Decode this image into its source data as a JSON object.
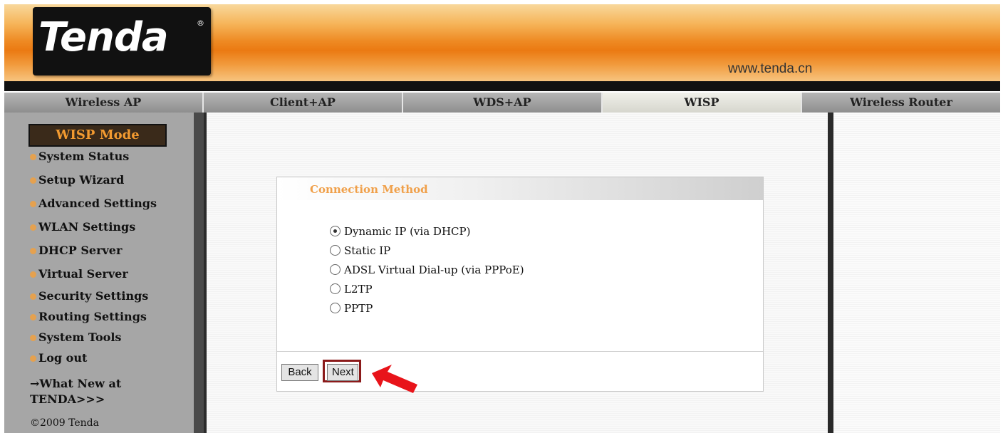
{
  "header": {
    "logo_text": "Tenda",
    "logo_mark": "®",
    "site_url": "www.tenda.cn"
  },
  "tabs": [
    {
      "label": "Wireless AP",
      "active": false
    },
    {
      "label": "Client+AP",
      "active": false
    },
    {
      "label": "WDS+AP",
      "active": false
    },
    {
      "label": "WISP",
      "active": true
    },
    {
      "label": "Wireless Router",
      "active": false
    }
  ],
  "sidebar": {
    "mode_title": "WISP Mode",
    "items": [
      {
        "label": "System Status"
      },
      {
        "label": "Setup Wizard"
      },
      {
        "label": "Advanced Settings"
      },
      {
        "label": "WLAN Settings"
      },
      {
        "label": "DHCP Server"
      },
      {
        "label": "Virtual Server"
      },
      {
        "label": "Security Settings"
      },
      {
        "label": "Routing Settings"
      },
      {
        "label": "System Tools"
      },
      {
        "label": "Log out"
      }
    ],
    "whats_new_line1": "→What New at",
    "whats_new_line2": "TENDA>>>",
    "copyright": "©2009 Tenda"
  },
  "connection": {
    "title": "Connection Method",
    "options": [
      {
        "label": "Dynamic IP (via DHCP)",
        "selected": true
      },
      {
        "label": "Static IP",
        "selected": false
      },
      {
        "label": "ADSL Virtual Dial-up (via PPPoE)",
        "selected": false
      },
      {
        "label": "L2TP",
        "selected": false
      },
      {
        "label": "PPTP",
        "selected": false
      }
    ],
    "back_label": "Back",
    "next_label": "Next"
  },
  "colors": {
    "brand_orange": "#eb7a12",
    "highlight_red": "#8b1a1a",
    "arrow_red": "#e8141a"
  }
}
